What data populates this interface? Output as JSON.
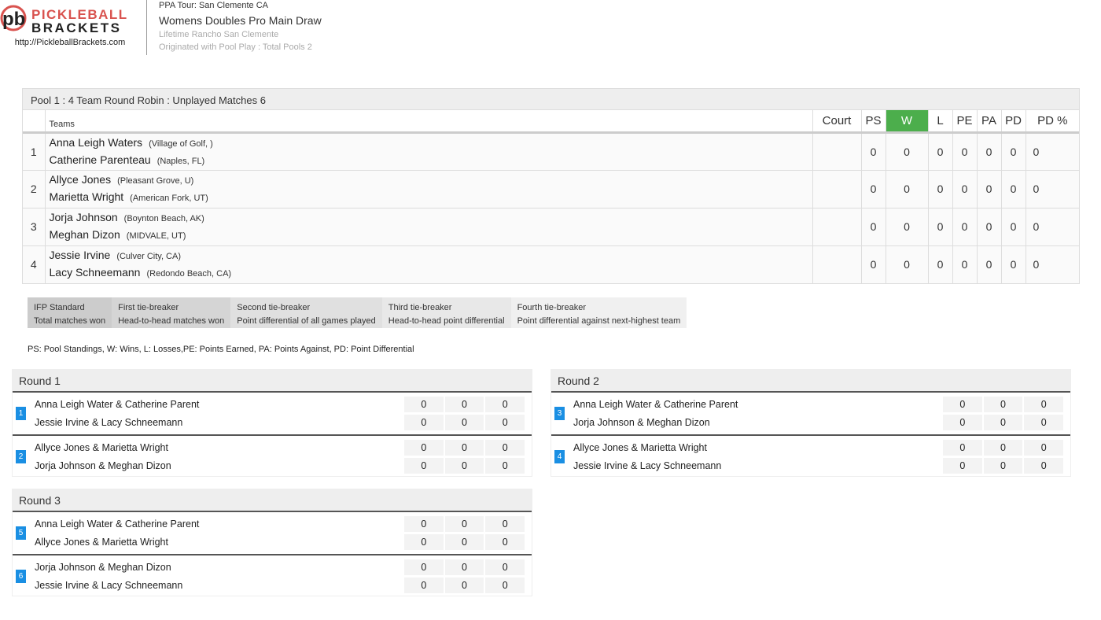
{
  "header": {
    "logo_top": "PICKLEBALL",
    "logo_bottom": "BRACKETS",
    "url": "http://PickleballBrackets.com",
    "tour": "PPA Tour: San Clemente CA",
    "event": "Womens Doubles Pro Main Draw",
    "venue": "Lifetime Rancho San Clemente",
    "origin": "Originated with Pool Play : Total Pools 2"
  },
  "colors": {
    "w_header": "#4cae4c",
    "match_badge": "#1a8fe3"
  },
  "pool": {
    "title": "Pool 1 : 4 Team Round Robin : Unplayed Matches 6",
    "columns": {
      "teams": "Teams",
      "court": "Court",
      "ps": "PS",
      "w": "W",
      "l": "L",
      "pe": "PE",
      "pa": "PA",
      "pd": "PD",
      "pd_pct": "PD %"
    },
    "rows": [
      {
        "rank": "1",
        "p1": "Anna Leigh Waters",
        "p1_loc": "(Village of Golf, )",
        "p2": "Catherine Parenteau",
        "p2_loc": "(Naples, FL)",
        "court": "",
        "ps": "0",
        "w": "0",
        "l": "0",
        "pe": "0",
        "pa": "0",
        "pd": "0",
        "pd_pct": "0"
      },
      {
        "rank": "2",
        "p1": "Allyce Jones",
        "p1_loc": "(Pleasant Grove, U)",
        "p2": "Marietta Wright",
        "p2_loc": "(American Fork, UT)",
        "court": "",
        "ps": "0",
        "w": "0",
        "l": "0",
        "pe": "0",
        "pa": "0",
        "pd": "0",
        "pd_pct": "0"
      },
      {
        "rank": "3",
        "p1": "Jorja Johnson",
        "p1_loc": "(Boynton Beach, AK)",
        "p2": "Meghan Dizon",
        "p2_loc": "(MIDVALE, UT)",
        "court": "",
        "ps": "0",
        "w": "0",
        "l": "0",
        "pe": "0",
        "pa": "0",
        "pd": "0",
        "pd_pct": "0"
      },
      {
        "rank": "4",
        "p1": "Jessie Irvine",
        "p1_loc": "(Culver City, CA)",
        "p2": "Lacy Schneemann",
        "p2_loc": "(Redondo Beach, CA)",
        "court": "",
        "ps": "0",
        "w": "0",
        "l": "0",
        "pe": "0",
        "pa": "0",
        "pd": "0",
        "pd_pct": "0"
      }
    ]
  },
  "tiebreakers": [
    {
      "title": "IFP Standard",
      "desc": "Total matches won"
    },
    {
      "title": "First tie-breaker",
      "desc": "Head-to-head matches won"
    },
    {
      "title": "Second tie-breaker",
      "desc": "Point differential of all games played"
    },
    {
      "title": "Third tie-breaker",
      "desc": "Head-to-head point differential"
    },
    {
      "title": "Fourth tie-breaker",
      "desc": "Point differential against next-highest team"
    }
  ],
  "legend": "PS: Pool Standings, W: Wins, L: Losses,PE: Points Earned, PA: Points Against, PD: Point Differential",
  "rounds": [
    {
      "title": "Round 1",
      "matches": [
        {
          "num": "1",
          "team1": "Anna Leigh Water & Catherine Parent",
          "team2": "Jessie Irvine & Lacy Schneemann",
          "s1": [
            "0",
            "0",
            "0"
          ],
          "s2": [
            "0",
            "0",
            "0"
          ]
        },
        {
          "num": "2",
          "team1": "Allyce Jones & Marietta Wright",
          "team2": "Jorja Johnson & Meghan Dizon",
          "s1": [
            "0",
            "0",
            "0"
          ],
          "s2": [
            "0",
            "0",
            "0"
          ]
        }
      ]
    },
    {
      "title": "Round 2",
      "matches": [
        {
          "num": "3",
          "team1": "Anna Leigh Water & Catherine Parent",
          "team2": "Jorja Johnson & Meghan Dizon",
          "s1": [
            "0",
            "0",
            "0"
          ],
          "s2": [
            "0",
            "0",
            "0"
          ]
        },
        {
          "num": "4",
          "team1": "Allyce Jones & Marietta Wright",
          "team2": "Jessie Irvine & Lacy Schneemann",
          "s1": [
            "0",
            "0",
            "0"
          ],
          "s2": [
            "0",
            "0",
            "0"
          ]
        }
      ]
    },
    {
      "title": "Round 3",
      "matches": [
        {
          "num": "5",
          "team1": "Anna Leigh Water & Catherine Parent",
          "team2": "Allyce Jones & Marietta Wright",
          "s1": [
            "0",
            "0",
            "0"
          ],
          "s2": [
            "0",
            "0",
            "0"
          ]
        },
        {
          "num": "6",
          "team1": "Jorja Johnson & Meghan Dizon",
          "team2": "Jessie Irvine & Lacy Schneemann",
          "s1": [
            "0",
            "0",
            "0"
          ],
          "s2": [
            "0",
            "0",
            "0"
          ]
        }
      ]
    }
  ]
}
